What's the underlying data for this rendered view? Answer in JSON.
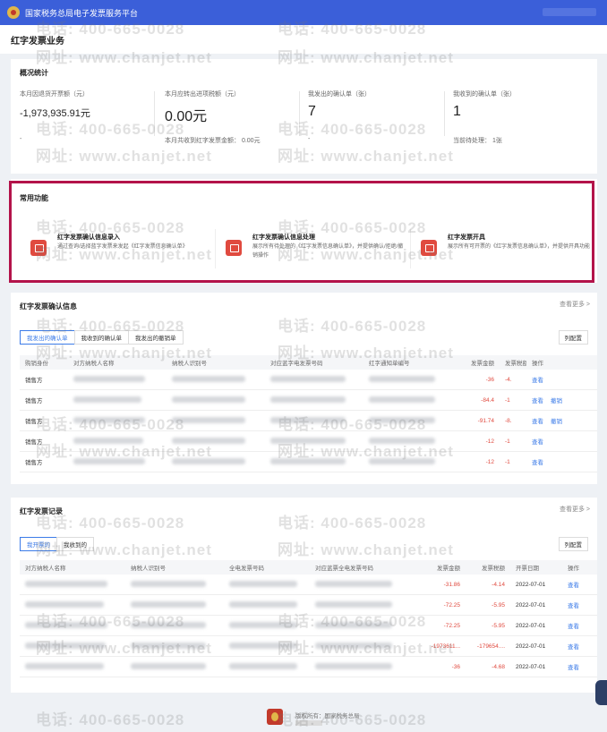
{
  "header": {
    "platform_title": "国家税务总局电子发票服务平台"
  },
  "page": {
    "title": "红字发票业务"
  },
  "overview": {
    "title": "概况统计",
    "stats": [
      {
        "label": "本月因退货开票额（元）",
        "value": "-1,973,935.91元",
        "sub": "-"
      },
      {
        "label": "本月应转出进项税额（元）",
        "value": "0.00元",
        "sub": "本月共收到红字发票金额： 0.00元"
      },
      {
        "label": "我发出的确认单（张）",
        "value": "7",
        "sub": "-"
      },
      {
        "label": "我收到的确认单（张）",
        "value": "1",
        "sub": "当前待处理： 1张"
      }
    ]
  },
  "common": {
    "title": "常用功能",
    "functions": [
      {
        "name": "红字发票确认信息录入",
        "desc": "通过查询/选择蓝字发票来发起《红字发票信息确认单》",
        "icon": "entry-icon"
      },
      {
        "name": "红字发票确认信息处理",
        "desc": "展示所有待处理的《红字发票信息确认单》，并提供确认/拒绝/撤销操作",
        "icon": "process-icon"
      },
      {
        "name": "红字发票开具",
        "desc": "展示所有可开票的《红字发票信息确认单》，并提供开具功能",
        "icon": "issue-icon"
      }
    ]
  },
  "confirm": {
    "title": "红字发票确认信息",
    "more": "查看更多 >",
    "tabs": [
      "我发出的确认单",
      "我收到的确认单",
      "我发出的撤销单"
    ],
    "col_config": "列配置",
    "columns": [
      "购销身份",
      "对方纳税人名称",
      "纳税人识别号",
      "对应蓝字电发票号码",
      "红字通知单编号",
      "发票金额",
      "发票税额",
      "操作"
    ],
    "rows": [
      {
        "role": "销售方",
        "amount": "-36",
        "tax": "-4.",
        "ops": [
          "查看"
        ]
      },
      {
        "role": "销售方",
        "amount": "-84.4",
        "tax": "-1",
        "ops": [
          "查看",
          "撤销"
        ]
      },
      {
        "role": "销售方",
        "amount": "-91.74",
        "tax": "-8.",
        "ops": [
          "查看",
          "撤销"
        ]
      },
      {
        "role": "销售方",
        "amount": "-12",
        "tax": "-1",
        "ops": [
          "查看"
        ]
      },
      {
        "role": "销售方",
        "amount": "-12",
        "tax": "-1",
        "ops": [
          "查看"
        ]
      }
    ]
  },
  "records": {
    "title": "红字发票记录",
    "more": "查看更多 >",
    "tabs": [
      "我开票的",
      "我收到的"
    ],
    "col_config": "列配置",
    "columns": [
      "对方纳税人名称",
      "纳税人识别号",
      "全电发票号码",
      "对应蓝票全电发票号码",
      "发票金额",
      "发票税额",
      "开票日期",
      "操作"
    ],
    "rows": [
      {
        "amount": "-31.86",
        "tax": "-4.14",
        "date": "2022-07-01",
        "op": "查看"
      },
      {
        "amount": "-72.25",
        "tax": "-5.95",
        "date": "2022-07-01",
        "op": "查看"
      },
      {
        "amount": "-72.25",
        "tax": "-5.95",
        "date": "2022-07-01",
        "op": "查看"
      },
      {
        "amount": "-1973611...",
        "tax": "-179654....",
        "date": "2022-07-01",
        "op": "查看"
      },
      {
        "amount": "-36",
        "tax": "-4.68",
        "date": "2022-07-01",
        "op": "查看"
      }
    ]
  },
  "footer": {
    "owner": "版权所有：国家税务总局"
  },
  "watermark": {
    "phone": "电话: 400-665-0028",
    "site": "网址: www.chanjet.net"
  },
  "colors": {
    "brand_blue": "#3b5fd9",
    "negative_red": "#e04a3f",
    "link_blue": "#3b7be8",
    "highlight_border": "#b3134a"
  }
}
